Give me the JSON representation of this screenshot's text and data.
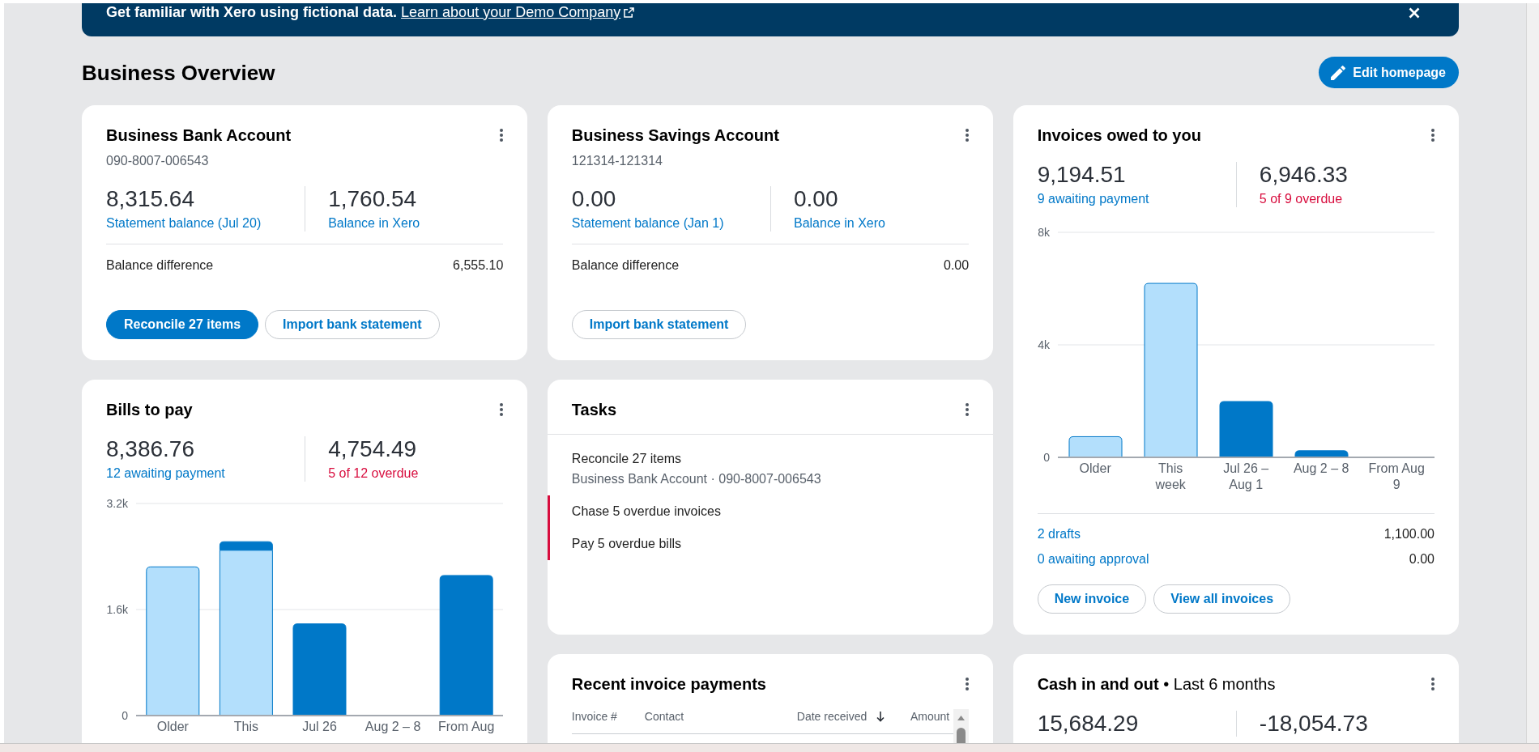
{
  "banner": {
    "message": "Get familiar with Xero using fictional data.",
    "link": "Learn about your Demo Company"
  },
  "page_title": "Business Overview",
  "edit_button": "Edit homepage",
  "bank_accounts": [
    {
      "name": "Business Bank Account",
      "number": "090-8007-006543",
      "stats": [
        {
          "value": "8,315.64",
          "label": "Statement balance (Jul 20)"
        },
        {
          "value": "1,760.54",
          "label": "Balance in Xero"
        }
      ],
      "difference": {
        "label": "Balance difference",
        "value": "6,555.10"
      },
      "buttons": [
        {
          "label": "Reconcile 27 items",
          "primary": true
        },
        {
          "label": "Import bank statement",
          "primary": false
        }
      ]
    },
    {
      "name": "Business Savings Account",
      "number": "121314-121314",
      "stats": [
        {
          "value": "0.00",
          "label": "Statement balance (Jan 1)"
        },
        {
          "value": "0.00",
          "label": "Balance in Xero"
        }
      ],
      "difference": {
        "label": "Balance difference",
        "value": "0.00"
      },
      "buttons": [
        {
          "label": "Import bank statement",
          "primary": false
        }
      ]
    }
  ],
  "invoices_owed": {
    "title": "Invoices owed to you",
    "stats": [
      {
        "value": "9,194.51",
        "label": "9 awaiting payment",
        "overdue": false
      },
      {
        "value": "6,946.33",
        "label": "5 of 9 overdue",
        "overdue": true
      }
    ],
    "chart_data": {
      "type": "bar",
      "categories": [
        "Older",
        "This week",
        "Jul 26 – Aug 1",
        "Aug 2 – 8",
        "From Aug 9"
      ],
      "series": [
        {
          "color": "#b3dffc",
          "values": [
            750,
            6200,
            0,
            0,
            0
          ]
        },
        {
          "color": "#0078c8",
          "values": [
            0,
            0,
            2000,
            250,
            0
          ]
        }
      ],
      "stacked": true,
      "ylim": [
        0,
        8000
      ],
      "yticks": [
        {
          "value": 0,
          "label": "0"
        },
        {
          "value": 4000,
          "label": "4k"
        },
        {
          "value": 8000,
          "label": "8k"
        }
      ]
    },
    "summary": [
      {
        "label": "2 drafts",
        "value": "1,100.00"
      },
      {
        "label": "0 awaiting approval",
        "value": "0.00"
      }
    ],
    "buttons": [
      {
        "label": "New invoice",
        "primary": false
      },
      {
        "label": "View all invoices",
        "primary": false
      }
    ]
  },
  "bills_to_pay": {
    "title": "Bills to pay",
    "stats": [
      {
        "value": "8,386.76",
        "label": "12 awaiting payment",
        "overdue": false
      },
      {
        "value": "4,754.49",
        "label": "5 of 12 overdue",
        "overdue": true
      }
    ],
    "chart_data": {
      "type": "bar",
      "categories": [
        "Older",
        "This",
        "Jul 26",
        "Aug 2 – 8",
        "From Aug"
      ],
      "series": [
        {
          "color": "#b3dffc",
          "values": [
            2250,
            2500,
            0,
            0,
            0
          ]
        },
        {
          "color": "#0078c8",
          "values": [
            0,
            130,
            1390,
            0,
            2120
          ]
        }
      ],
      "stacked": true,
      "ylim": [
        0,
        3200
      ],
      "yticks": [
        {
          "value": 0,
          "label": "0"
        },
        {
          "value": 1600,
          "label": "1.6k"
        },
        {
          "value": 3200,
          "label": "3.2k"
        }
      ]
    }
  },
  "tasks": {
    "title": "Tasks",
    "items": [
      {
        "title": "Reconcile 27 items",
        "detail": "Business Bank Account · 090-8007-006543",
        "overdue": false
      },
      {
        "title": "Chase 5 overdue invoices",
        "overdue": true
      },
      {
        "title": "Pay 5 overdue bills",
        "overdue": true
      }
    ]
  },
  "recent_invoice_payments": {
    "title": "Recent invoice payments",
    "columns": [
      {
        "label": "Invoice #",
        "sorted": false
      },
      {
        "label": "Contact",
        "sorted": false
      },
      {
        "label": "Date received",
        "sorted": true
      },
      {
        "label": "Amount",
        "sorted": false
      }
    ]
  },
  "cash_in_and_out": {
    "title": "**Cash in and out** • Last 6 months",
    "stats": [
      {
        "value": "15,684.29"
      },
      {
        "value": "-18,054.73"
      }
    ]
  }
}
